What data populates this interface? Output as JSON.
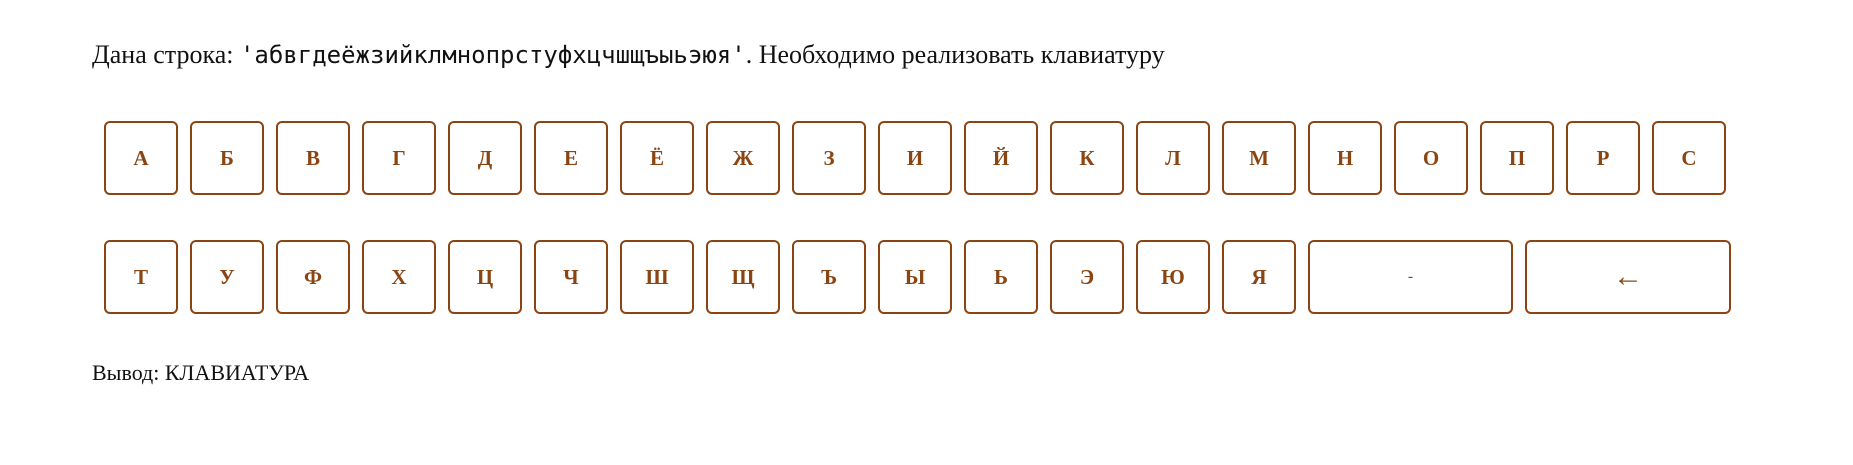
{
  "task": {
    "prefix": "Дана строка: ",
    "code": "'абвгдеёжзийклмнопрстуфхцчшщъыьэюя'",
    "suffix": ". Необходимо реализовать клавиатуру"
  },
  "keyboard": {
    "row1": [
      "А",
      "Б",
      "В",
      "Г",
      "Д",
      "Е",
      "Ё",
      "Ж",
      "З",
      "И",
      "Й",
      "К",
      "Л",
      "М",
      "Н",
      "О",
      "П",
      "Р",
      "С"
    ],
    "row2": [
      "Т",
      "У",
      "Ф",
      "Х",
      "Ц",
      "Ч",
      "Ш",
      "Щ",
      "Ъ",
      "Ы",
      "Ь",
      "Э",
      "Ю",
      "Я"
    ],
    "space_label": "-",
    "backspace_label": "←"
  },
  "output": {
    "label": "Вывод: ",
    "value": "КЛАВИАТУРА"
  },
  "colors": {
    "key_border": "#8b4513",
    "key_text": "#8b4513"
  }
}
